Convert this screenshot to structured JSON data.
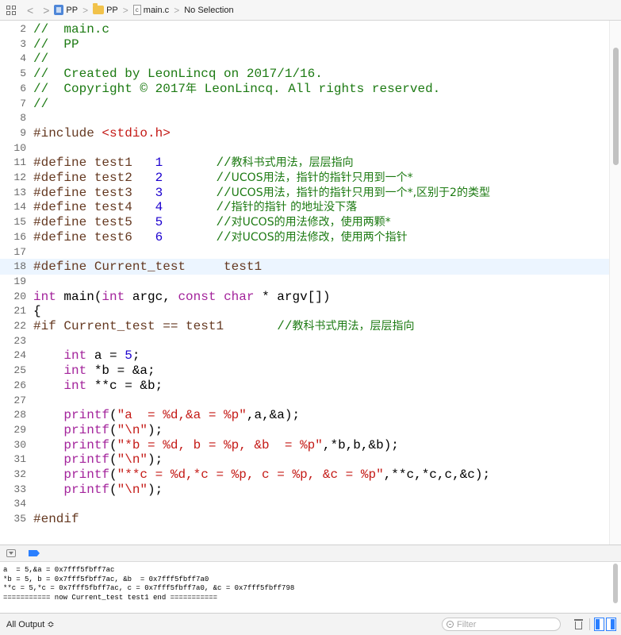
{
  "jump_bar": {
    "nav_back": "<",
    "nav_forward": ">",
    "crumbs": [
      "PP",
      "PP",
      "main.c",
      "No Selection"
    ],
    "c_glyph": "c",
    "separator": ">"
  },
  "editor": {
    "current_line": 18,
    "lines": [
      {
        "n": "2",
        "tokens": [
          {
            "t": "//  main.c",
            "c": "cmt"
          }
        ]
      },
      {
        "n": "3",
        "tokens": [
          {
            "t": "//  PP",
            "c": "cmt"
          }
        ]
      },
      {
        "n": "4",
        "tokens": [
          {
            "t": "//",
            "c": "cmt"
          }
        ]
      },
      {
        "n": "5",
        "tokens": [
          {
            "t": "//  Created by LeonLincq on 2017/1/16.",
            "c": "cmt"
          }
        ]
      },
      {
        "n": "6",
        "tokens": [
          {
            "t": "//  Copyright © 2017",
            "c": "cmt"
          },
          {
            "t": "年",
            "c": "cmt cjk"
          },
          {
            "t": " LeonLincq. All rights reserved.",
            "c": "cmt"
          }
        ]
      },
      {
        "n": "7",
        "tokens": [
          {
            "t": "//",
            "c": "cmt"
          }
        ]
      },
      {
        "n": "8",
        "tokens": []
      },
      {
        "n": "9",
        "tokens": [
          {
            "t": "#include ",
            "c": "dir"
          },
          {
            "t": "<stdio.h>",
            "c": "str"
          }
        ]
      },
      {
        "n": "10",
        "tokens": []
      },
      {
        "n": "11",
        "tokens": [
          {
            "t": "#define test1   ",
            "c": "dir"
          },
          {
            "t": "1",
            "c": "num"
          },
          {
            "t": "       ",
            "c": ""
          },
          {
            "t": "//",
            "c": "cmt"
          },
          {
            "t": "教科书式用法，层层指向",
            "c": "cmt cjk"
          }
        ]
      },
      {
        "n": "12",
        "tokens": [
          {
            "t": "#define test2   ",
            "c": "dir"
          },
          {
            "t": "2",
            "c": "num"
          },
          {
            "t": "       ",
            "c": ""
          },
          {
            "t": "//",
            "c": "cmt"
          },
          {
            "t": "UCOS用法，指针的指针只用到一个*",
            "c": "cmt cjk"
          }
        ]
      },
      {
        "n": "13",
        "tokens": [
          {
            "t": "#define test3   ",
            "c": "dir"
          },
          {
            "t": "3",
            "c": "num"
          },
          {
            "t": "       ",
            "c": ""
          },
          {
            "t": "//",
            "c": "cmt"
          },
          {
            "t": "UCOS用法，指针的指针只用到一个*,区别于2的类型",
            "c": "cmt cjk"
          }
        ]
      },
      {
        "n": "14",
        "tokens": [
          {
            "t": "#define test4   ",
            "c": "dir"
          },
          {
            "t": "4",
            "c": "num"
          },
          {
            "t": "       ",
            "c": ""
          },
          {
            "t": "//",
            "c": "cmt"
          },
          {
            "t": "指针的指针 的地址没下落",
            "c": "cmt cjk"
          }
        ]
      },
      {
        "n": "15",
        "tokens": [
          {
            "t": "#define test5   ",
            "c": "dir"
          },
          {
            "t": "5",
            "c": "num"
          },
          {
            "t": "       ",
            "c": ""
          },
          {
            "t": "//",
            "c": "cmt"
          },
          {
            "t": "对UCOS的用法修改，使用两颗*",
            "c": "cmt cjk"
          }
        ]
      },
      {
        "n": "16",
        "tokens": [
          {
            "t": "#define test6   ",
            "c": "dir"
          },
          {
            "t": "6",
            "c": "num"
          },
          {
            "t": "       ",
            "c": ""
          },
          {
            "t": "//",
            "c": "cmt"
          },
          {
            "t": "对UCOS的用法修改，使用两个指针",
            "c": "cmt cjk"
          }
        ]
      },
      {
        "n": "17",
        "tokens": []
      },
      {
        "n": "18",
        "tokens": [
          {
            "t": "#define Current_test     test1",
            "c": "dir"
          }
        ]
      },
      {
        "n": "19",
        "tokens": []
      },
      {
        "n": "20",
        "tokens": [
          {
            "t": "int",
            "c": "kw"
          },
          {
            "t": " main(",
            "c": ""
          },
          {
            "t": "int",
            "c": "kw"
          },
          {
            "t": " argc, ",
            "c": ""
          },
          {
            "t": "const",
            "c": "kw"
          },
          {
            "t": " ",
            "c": ""
          },
          {
            "t": "char",
            "c": "kw"
          },
          {
            "t": " * argv[])",
            "c": ""
          }
        ]
      },
      {
        "n": "21",
        "tokens": [
          {
            "t": "{",
            "c": ""
          }
        ]
      },
      {
        "n": "22",
        "tokens": [
          {
            "t": "#if Current_test == test1       ",
            "c": "dir"
          },
          {
            "t": "//",
            "c": "cmt"
          },
          {
            "t": "教科书式用法，层层指向",
            "c": "cmt cjk"
          }
        ]
      },
      {
        "n": "23",
        "tokens": []
      },
      {
        "n": "24",
        "tokens": [
          {
            "t": "    ",
            "c": ""
          },
          {
            "t": "int",
            "c": "kw"
          },
          {
            "t": " a = ",
            "c": ""
          },
          {
            "t": "5",
            "c": "num"
          },
          {
            "t": ";",
            "c": ""
          }
        ]
      },
      {
        "n": "25",
        "tokens": [
          {
            "t": "    ",
            "c": ""
          },
          {
            "t": "int",
            "c": "kw"
          },
          {
            "t": " *b = &a;",
            "c": ""
          }
        ]
      },
      {
        "n": "26",
        "tokens": [
          {
            "t": "    ",
            "c": ""
          },
          {
            "t": "int",
            "c": "kw"
          },
          {
            "t": " **c = &b;",
            "c": ""
          }
        ]
      },
      {
        "n": "27",
        "tokens": []
      },
      {
        "n": "28",
        "tokens": [
          {
            "t": "    ",
            "c": ""
          },
          {
            "t": "printf",
            "c": "kw"
          },
          {
            "t": "(",
            "c": ""
          },
          {
            "t": "\"a  = %d,&a = %p\"",
            "c": "str"
          },
          {
            "t": ",a,&a);",
            "c": ""
          }
        ]
      },
      {
        "n": "29",
        "tokens": [
          {
            "t": "    ",
            "c": ""
          },
          {
            "t": "printf",
            "c": "kw"
          },
          {
            "t": "(",
            "c": ""
          },
          {
            "t": "\"\\n\"",
            "c": "str"
          },
          {
            "t": ");",
            "c": ""
          }
        ]
      },
      {
        "n": "30",
        "tokens": [
          {
            "t": "    ",
            "c": ""
          },
          {
            "t": "printf",
            "c": "kw"
          },
          {
            "t": "(",
            "c": ""
          },
          {
            "t": "\"*b = %d, b = %p, &b  = %p\"",
            "c": "str"
          },
          {
            "t": ",*b,b,&b);",
            "c": ""
          }
        ]
      },
      {
        "n": "31",
        "tokens": [
          {
            "t": "    ",
            "c": ""
          },
          {
            "t": "printf",
            "c": "kw"
          },
          {
            "t": "(",
            "c": ""
          },
          {
            "t": "\"\\n\"",
            "c": "str"
          },
          {
            "t": ");",
            "c": ""
          }
        ]
      },
      {
        "n": "32",
        "tokens": [
          {
            "t": "    ",
            "c": ""
          },
          {
            "t": "printf",
            "c": "kw"
          },
          {
            "t": "(",
            "c": ""
          },
          {
            "t": "\"**c = %d,*c = %p, c = %p, &c = %p\"",
            "c": "str"
          },
          {
            "t": ",**c,*c,c,&c);",
            "c": ""
          }
        ]
      },
      {
        "n": "33",
        "tokens": [
          {
            "t": "    ",
            "c": ""
          },
          {
            "t": "printf",
            "c": "kw"
          },
          {
            "t": "(",
            "c": ""
          },
          {
            "t": "\"\\n\"",
            "c": "str"
          },
          {
            "t": ");",
            "c": ""
          }
        ]
      },
      {
        "n": "34",
        "tokens": []
      },
      {
        "n": "35",
        "tokens": [
          {
            "t": "#endif",
            "c": "dir"
          }
        ]
      }
    ]
  },
  "console": {
    "lines": [
      "a  = 5,&a = 0x7fff5fbff7ac",
      "*b = 5, b = 0x7fff5fbff7ac, &b  = 0x7fff5fbff7a0",
      "**c = 5,*c = 0x7fff5fbff7ac, c = 0x7fff5fbff7a0, &c = 0x7fff5fbff798",
      "=========== now Current_test test1 end ==========="
    ]
  },
  "footer": {
    "output_selector": "All Output ≎",
    "filter_placeholder": "Filter"
  },
  "colors": {
    "comment": "#1c7a12",
    "keyword": "#a3239b",
    "string": "#c41a16",
    "number": "#1c00cf",
    "directive": "#643820",
    "current_line_bg": "#ecf5ff",
    "accent": "#2a7fff"
  }
}
